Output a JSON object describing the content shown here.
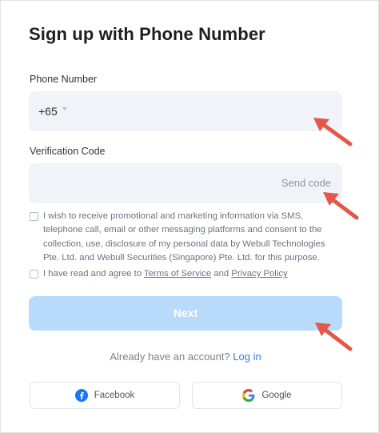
{
  "header": {
    "title": "Sign up with Phone Number"
  },
  "phone": {
    "label": "Phone Number",
    "country_code": "+65",
    "value": ""
  },
  "verification": {
    "label": "Verification Code",
    "value": "",
    "send_code_label": "Send code"
  },
  "consent": {
    "marketing_text": "I wish to receive promotional and marketing information via SMS, telephone call, email or other messaging platforms and consent to the collection, use, disclosure of my personal data by Webull Technologies Pte. Ltd. and Webull Securities (Singapore) Pte. Ltd. for this purpose.",
    "terms_prefix": "I have read and agree to",
    "terms_link": "Terms of Service",
    "terms_and": "and",
    "privacy_link": "Privacy Policy"
  },
  "actions": {
    "next_label": "Next"
  },
  "footer": {
    "already_text": "Already have an account?",
    "login_label": "Log in"
  },
  "social": {
    "facebook_label": "Facebook",
    "google_label": "Google"
  },
  "colors": {
    "accent": "#2f7fe8",
    "next_disabled": "#b8dbfb",
    "annotation_arrow": "#e4574a",
    "field_bg": "#f0f3f7"
  },
  "icons": [
    "chevron-down-icon",
    "facebook-icon",
    "google-icon",
    "annotation-arrow"
  ]
}
